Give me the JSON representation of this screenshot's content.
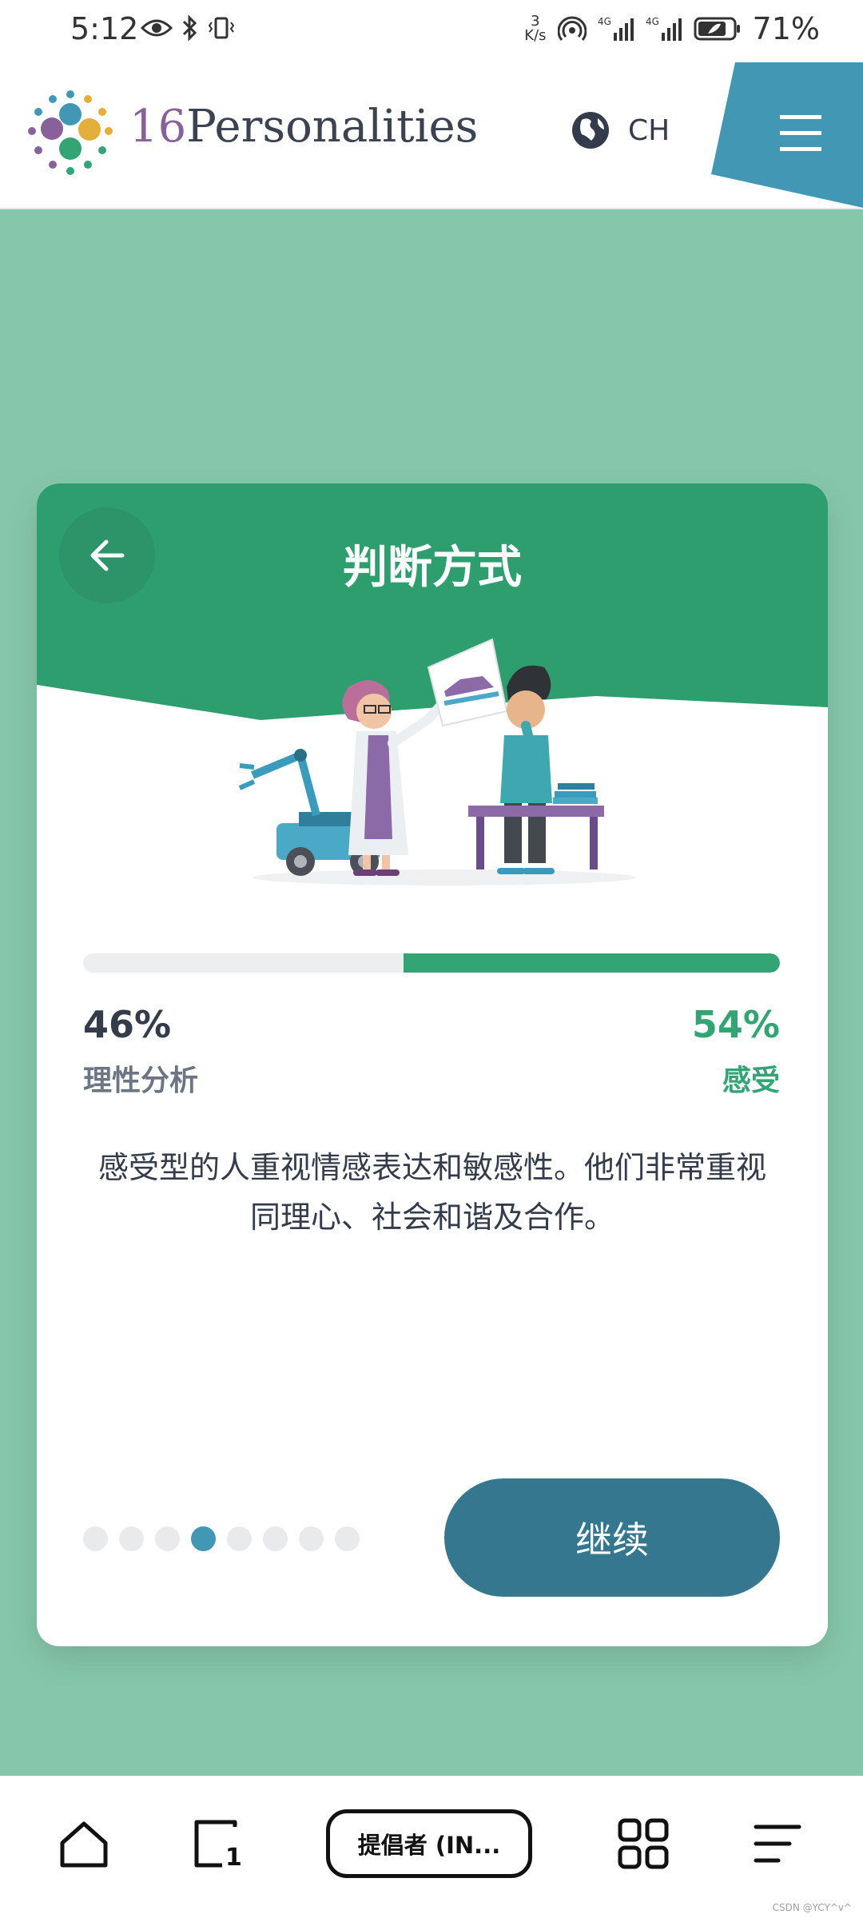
{
  "status_bar": {
    "time": "5:12",
    "speed_value": "3",
    "speed_unit": "K/s",
    "battery": "71%"
  },
  "header": {
    "brand_num": "16",
    "brand_name": "Personalities",
    "language": "CH"
  },
  "card": {
    "title": "判断方式",
    "left_percent": "46%",
    "left_label": "理性分析",
    "right_percent": "54%",
    "right_label": "感受",
    "right_fraction": 0.54,
    "description": "感受型的人重视情感表达和敏感性。他们非常重视同理心、社会和谐及合作。",
    "continue_label": "继续",
    "dots_total": 8,
    "dots_active_index": 3
  },
  "bottom_bar": {
    "tab_label": "提倡者 (IN..."
  },
  "watermark": "CSDN @YCY^v^",
  "colors": {
    "accent_green": "#33a474",
    "background_green": "#86c7ab",
    "header_green": "#2f9e6e",
    "button_blue": "#35778f",
    "active_dot": "#4298b4",
    "brand_purple": "#88619a"
  }
}
